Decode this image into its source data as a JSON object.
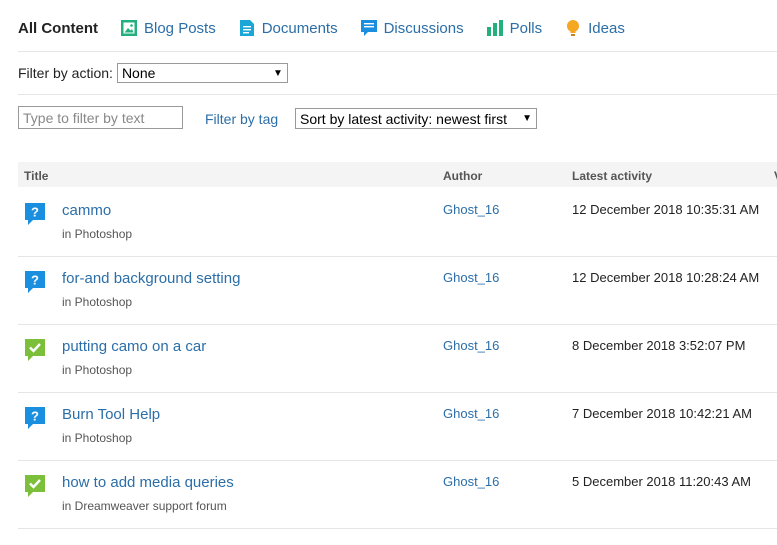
{
  "tabs": [
    {
      "label": "All Content",
      "icon": "none"
    },
    {
      "label": "Blog Posts",
      "icon": "image-icon"
    },
    {
      "label": "Documents",
      "icon": "document-icon"
    },
    {
      "label": "Discussions",
      "icon": "discussion-icon"
    },
    {
      "label": "Polls",
      "icon": "bar-chart-icon"
    },
    {
      "label": "Ideas",
      "icon": "lightbulb-icon"
    }
  ],
  "filter": {
    "action_label": "Filter by action:",
    "action_value": "None",
    "text_placeholder": "Type to filter by text",
    "tag_link": "Filter by tag",
    "sort_value": "Sort by latest activity: newest first"
  },
  "table": {
    "columns": [
      "Title",
      "Author",
      "Latest activity",
      "V"
    ],
    "rows": [
      {
        "type": "question",
        "title": "cammo",
        "place": "in Photoshop",
        "author": "Ghost_16",
        "date": "12 December 2018 10:35:31 AM"
      },
      {
        "type": "question",
        "title": "for-and background setting",
        "place": "in Photoshop",
        "author": "Ghost_16",
        "date": "12 December 2018 10:28:24 AM"
      },
      {
        "type": "answered",
        "title": "putting camo on a car",
        "place": "in Photoshop",
        "author": "Ghost_16",
        "date": "8 December 2018 3:52:07 PM"
      },
      {
        "type": "question",
        "title": "Burn Tool Help",
        "place": "in Photoshop",
        "author": "Ghost_16",
        "date": "7 December 2018 10:42:21 AM"
      },
      {
        "type": "answered",
        "title": "how to add media queries",
        "place": "in Dreamweaver support forum",
        "author": "Ghost_16",
        "date": "5 December 2018 11:20:43 AM"
      }
    ]
  },
  "colors": {
    "link": "#2b6ea8",
    "question_icon": "#1a8fe0",
    "answered_icon": "#7cbf3a",
    "teal_icon": "#22b07d",
    "idea_icon": "#f5a623"
  }
}
